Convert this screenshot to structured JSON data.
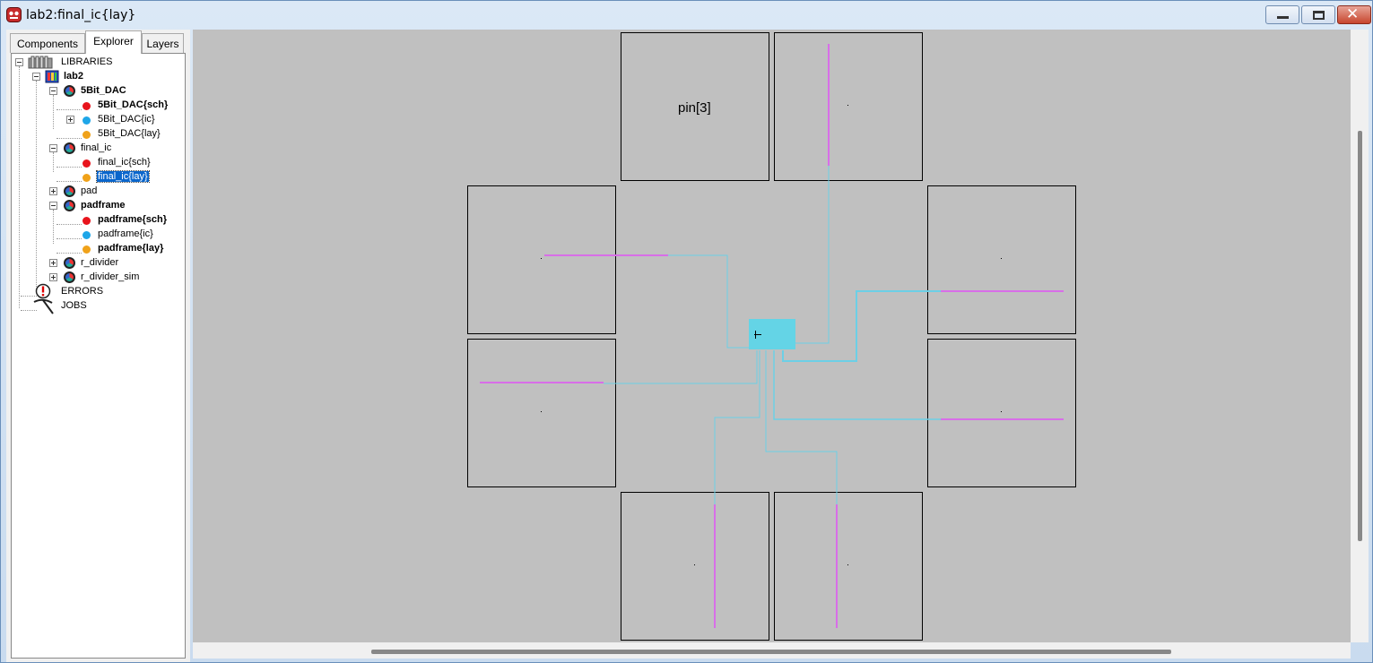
{
  "window": {
    "title": "lab2:final_ic{lay}"
  },
  "tabs": [
    {
      "label": "Components",
      "active": false
    },
    {
      "label": "Explorer",
      "active": true
    },
    {
      "label": "Layers",
      "active": false
    }
  ],
  "tree": {
    "libraries": "LIBRARIES",
    "lab2": "lab2",
    "dac": "5Bit_DAC",
    "dac_sch": "5Bit_DAC{sch}",
    "dac_ic": "5Bit_DAC{ic}",
    "dac_lay": "5Bit_DAC{lay}",
    "final_ic": "final_ic",
    "final_ic_sch": "final_ic{sch}",
    "final_ic_lay": "final_ic{lay}",
    "pad": "pad",
    "padframe": "padframe",
    "padframe_sch": "padframe{sch}",
    "padframe_ic": "padframe{ic}",
    "padframe_lay": "padframe{lay}",
    "r_divider": "r_divider",
    "r_divider_sim": "r_divider_sim",
    "errors": "ERRORS",
    "jobs": "JOBS"
  },
  "canvas": {
    "pad_label": "pin[3]"
  },
  "colors": {
    "canvas_bg": "#c0c0c0",
    "wire_cyan": "#6ccfe6",
    "metal_magenta": "#d86ee8",
    "view_sch": "#e8141c",
    "view_ic": "#1ea6e8",
    "view_lay": "#f0a21a",
    "selection": "#0a66cc"
  },
  "icons": {
    "app": "electric-app-icon",
    "libraries": "libraries-icon",
    "library": "library-icon",
    "cell": "cell-icon",
    "errors": "error-icon",
    "jobs": "jobs-icon"
  }
}
